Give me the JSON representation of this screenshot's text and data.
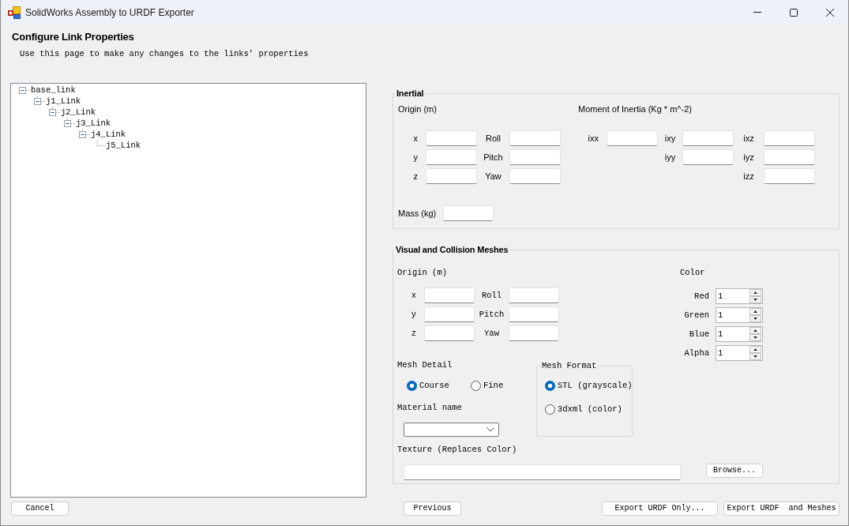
{
  "window": {
    "title": "SolidWorks Assembly to URDF Exporter"
  },
  "header": {
    "title": "Configure Link Properties",
    "subtitle": "Use this page to make any changes to the links’ properties"
  },
  "link_tree": [
    {
      "label": "base_link",
      "expanded": true,
      "children": [
        {
          "label": "j1_Link",
          "expanded": true,
          "children": [
            {
              "label": "j2_Link",
              "expanded": true,
              "children": [
                {
                  "label": "j3_Link",
                  "expanded": true,
                  "children": [
                    {
                      "label": "j4_Link",
                      "expanded": true,
                      "children": [
                        {
                          "label": "j5_Link"
                        }
                      ]
                    }
                  ]
                }
              ]
            }
          ]
        }
      ]
    }
  ],
  "inertial": {
    "title": "Inertial",
    "origin": {
      "label": "Origin (m)",
      "fields": [
        {
          "label": "x"
        },
        {
          "label": "Roll"
        },
        {
          "label": "y"
        },
        {
          "label": "Pitch"
        },
        {
          "label": "z"
        },
        {
          "label": "Yaw"
        }
      ]
    },
    "moment_of_inertia": {
      "label": "Moment of Inertia (Kg * m^-2)",
      "fields": [
        {
          "label": "ixx"
        },
        {
          "label": "ixy"
        },
        {
          "label": "ixz"
        },
        {
          "label": "iyy"
        },
        {
          "label": "iyz"
        },
        {
          "label": "izz"
        }
      ]
    },
    "mass": {
      "label": "Mass (kg)"
    }
  },
  "visual_and_collision_meshes": {
    "title": "Visual and Collision Meshes",
    "origin": {
      "label": "Origin (m)",
      "fields": [
        {
          "label": "x"
        },
        {
          "label": "Roll"
        },
        {
          "label": "y"
        },
        {
          "label": "Pitch"
        },
        {
          "label": "z"
        },
        {
          "label": "Yaw"
        }
      ]
    },
    "color": {
      "label": "Color",
      "channels": [
        {
          "label": "Red",
          "value": "1"
        },
        {
          "label": "Green",
          "value": "1"
        },
        {
          "label": "Blue",
          "value": "1"
        },
        {
          "label": "Alpha",
          "value": "1"
        }
      ]
    },
    "mesh_detail": {
      "label": "Mesh Detail",
      "options": [
        {
          "label": "Course",
          "selected": true
        },
        {
          "label": "Fine",
          "selected": false
        }
      ]
    },
    "mesh_format": {
      "title": "Mesh Format",
      "options": [
        {
          "label": "STL (grayscale)",
          "selected": true
        },
        {
          "label": "3dxml (color)",
          "selected": false
        }
      ]
    },
    "material_name": {
      "label": "Material name"
    },
    "texture": {
      "label": "Texture (Replaces Color)",
      "button": "Browse..."
    }
  },
  "buttons": [
    {
      "label": "Cancel"
    },
    {
      "label": "Previous"
    },
    {
      "label": "Export URDF Only..."
    },
    {
      "label": "Export URDF  and Meshes"
    }
  ]
}
